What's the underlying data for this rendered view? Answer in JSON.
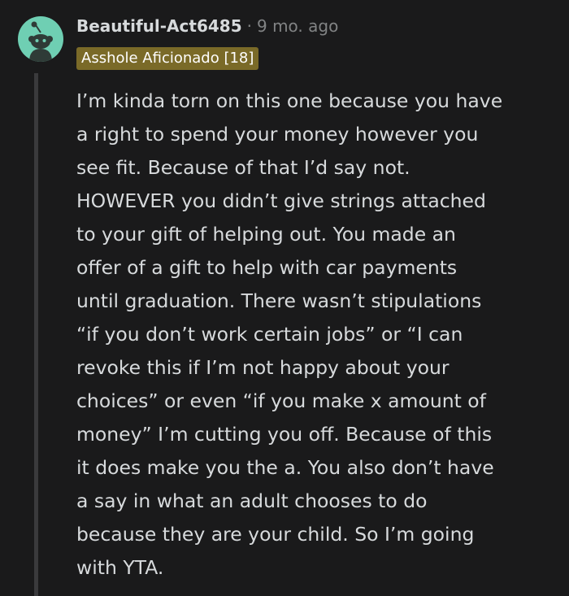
{
  "comment": {
    "author": "Beautiful-Act6485",
    "separator": "·",
    "timestamp": "9 mo. ago",
    "flair": "Asshole Aficionado [18]",
    "body": "I’m kinda torn on this one because you have\na right to spend your money however you\nsee fit. Because of that I’d say not.\nHOWEVER you didn’t give strings attached\nto your gift of helping out. You made an\noffer of a gift to help with car payments\nuntil graduation. There wasn’t stipulations\n“if you don’t work certain jobs” or “I can\nrevoke this if I’m not happy about your\nchoices” or even “if you make x amount of\nmoney” I’m cutting you off. Because of this\nit does make you the a. You also don’t have\na say in what an adult chooses to do\nbecause they are your child. So I’m going\nwith YTA."
  },
  "avatar": {
    "icon": "snoo-avatar-icon",
    "background": "#6fcfb3"
  },
  "colors": {
    "background": "#1a1a1b",
    "text": "#d7dadc",
    "muted": "#818384",
    "flair_background": "#7a6a28",
    "thread_line": "#3a3a3c"
  }
}
